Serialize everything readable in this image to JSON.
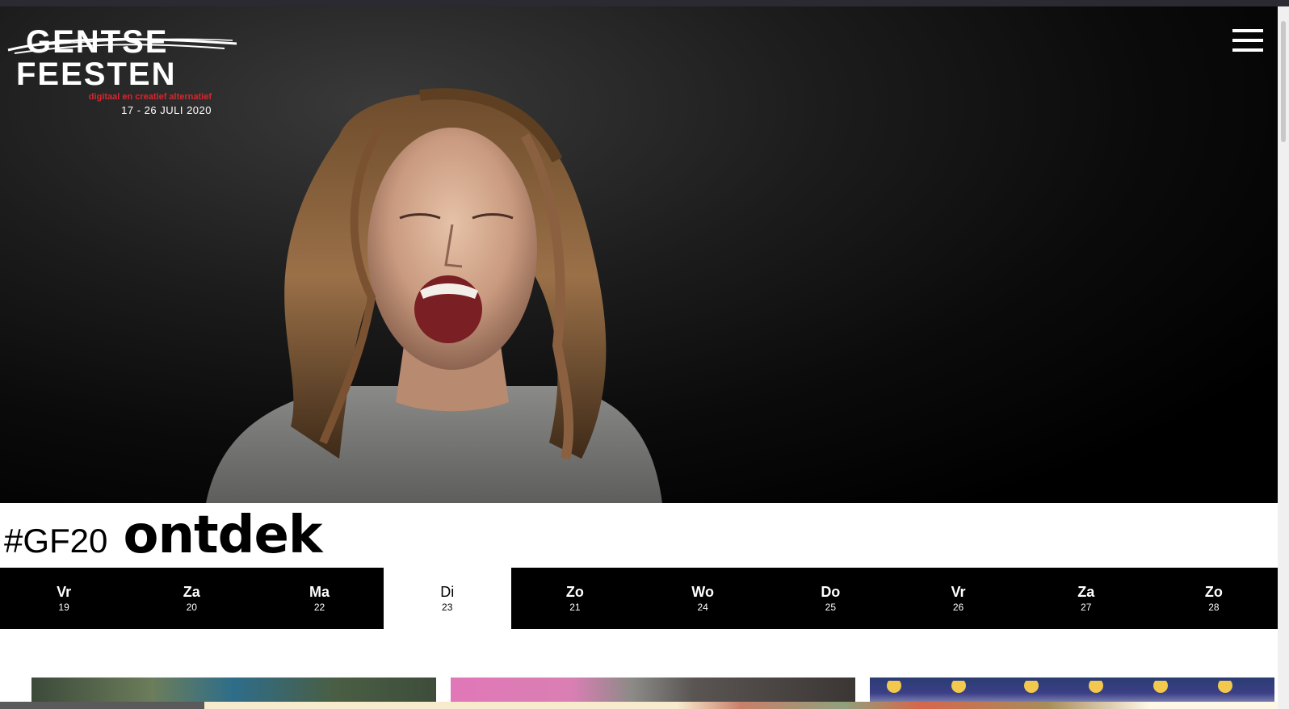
{
  "logo": {
    "line1": "GENTSE",
    "line2": "FEESTEN",
    "subtitle": "digitaal en creatief alternatief",
    "dates": "17 - 26 JULI 2020"
  },
  "menu": {
    "icon": "hamburger-menu-icon"
  },
  "hero": {
    "image": "portrait-man-long-hair-shouting"
  },
  "heading": {
    "tag": "#GF20",
    "title": "ontdek"
  },
  "days": [
    {
      "name": "Vr",
      "num": "19",
      "active": false
    },
    {
      "name": "Za",
      "num": "20",
      "active": false
    },
    {
      "name": "Ma",
      "num": "22",
      "active": false
    },
    {
      "name": "Di",
      "num": "23",
      "active": true
    },
    {
      "name": "Zo",
      "num": "21",
      "active": false
    },
    {
      "name": "Wo",
      "num": "24",
      "active": false
    },
    {
      "name": "Do",
      "num": "25",
      "active": false
    },
    {
      "name": "Vr",
      "num": "26",
      "active": false
    },
    {
      "name": "Za",
      "num": "27",
      "active": false
    },
    {
      "name": "Zo",
      "num": "28",
      "active": false
    }
  ],
  "colors": {
    "accent_red": "#d9262e",
    "active_day_bg": "#ffffff",
    "day_bar_bg": "#000000"
  }
}
